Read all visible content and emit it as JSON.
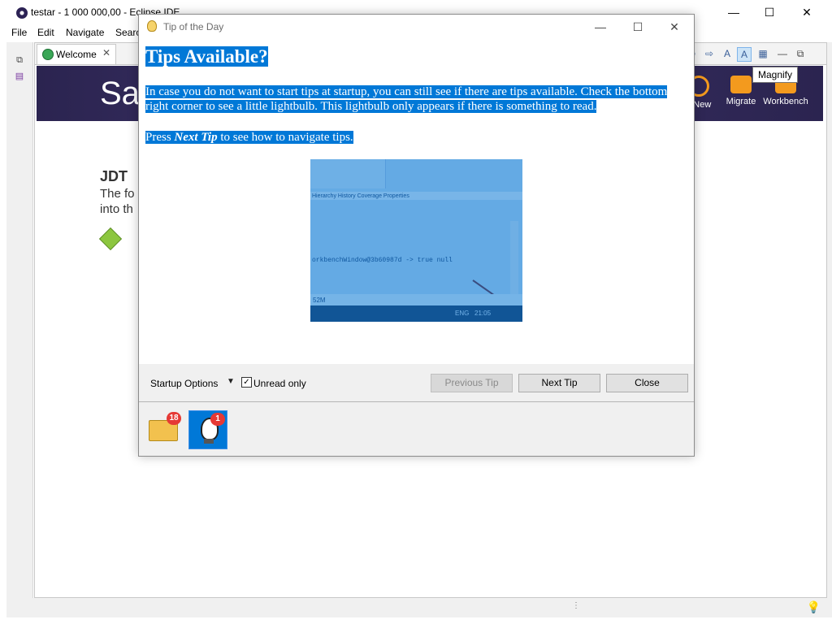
{
  "main_window": {
    "title": "testar - 1 000 000,00 - Eclipse IDE",
    "minimize": "—",
    "maximize": "☐",
    "close": "✕"
  },
  "menu": {
    "items": [
      "File",
      "Edit",
      "Navigate",
      "Search"
    ]
  },
  "editor": {
    "tab_label": "Welcome",
    "tab_close": "✕",
    "banner_title": "Sa",
    "banner_actions": [
      "s New",
      "Migrate",
      "Workbench"
    ],
    "section_title": "JDT",
    "section_desc_line1": "The fo",
    "section_desc_line2": "into th"
  },
  "tooltip": {
    "text": "Magnify"
  },
  "dialog": {
    "title": "Tip of the Day",
    "minimize": "—",
    "maximize": "☐",
    "close": "✕",
    "heading": "Tips Available?",
    "para1": "In case you do not want to start tips at startup, you can still see if there are tips available. Check the bottom right corner to see a little lightbulb. This lightbulb only appears if there is something to read.",
    "para2_prefix": "Press ",
    "para2_emphasis": "Next Tip",
    "para2_suffix": " to see how to navigate tips.",
    "screenshot": {
      "tabs": "Hierarchy  History  Coverage  Properties",
      "console_line": "orkbenchWindow@3b60987d -> true null",
      "status": "52M",
      "lang": "ENG",
      "time": "21:05"
    },
    "startup_options_label": "Startup Options",
    "unread_only_label": "Unread only",
    "unread_only_checked": true,
    "previous_tip_label": "Previous Tip",
    "next_tip_label": "Next Tip",
    "close_label": "Close",
    "providers": [
      {
        "icon": "folder-icon",
        "badge": "18"
      },
      {
        "icon": "lightbulb-icon",
        "badge": "1"
      }
    ]
  },
  "colors": {
    "selection": "#0078d7",
    "banner": "#2b2450",
    "accent_orange": "#f39a1e",
    "badge_red": "#e53935"
  }
}
